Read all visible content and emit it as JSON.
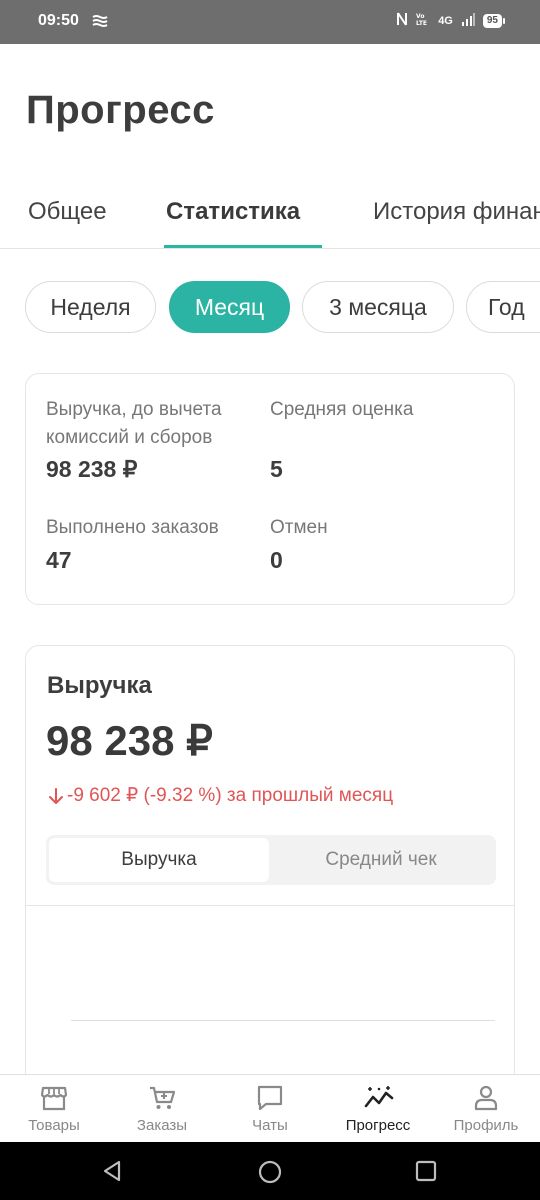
{
  "status_bar": {
    "time": "09:50",
    "network": "4G",
    "battery": "95"
  },
  "header": {
    "title": "Прогресс"
  },
  "tabs": [
    {
      "label": "Общее"
    },
    {
      "label": "Статистика"
    },
    {
      "label": "История финансов"
    }
  ],
  "periods": [
    {
      "label": "Неделя"
    },
    {
      "label": "Месяц"
    },
    {
      "label": "3 месяца"
    },
    {
      "label": "Год"
    }
  ],
  "summary": {
    "revenue_label": "Выручка, до вычета комиссий и сборов",
    "revenue_value": "98 238 ₽",
    "rating_label": "Средняя оценка",
    "rating_value": "5",
    "orders_label": "Выполнено заказов",
    "orders_value": "47",
    "cancels_label": "Отмен",
    "cancels_value": "0"
  },
  "revenue_card": {
    "title": "Выручка",
    "amount": "98 238 ₽",
    "change": "-9 602 ₽ (-9.32 %) за прошлый месяц",
    "change_color": "#e05555",
    "segments": [
      {
        "label": "Выручка"
      },
      {
        "label": "Средний чек"
      }
    ]
  },
  "bottom_nav": [
    {
      "label": "Товары",
      "icon": "store-icon"
    },
    {
      "label": "Заказы",
      "icon": "cart-icon"
    },
    {
      "label": "Чаты",
      "icon": "chat-icon"
    },
    {
      "label": "Прогресс",
      "icon": "progress-chart-icon"
    },
    {
      "label": "Профиль",
      "icon": "profile-icon"
    }
  ],
  "colors": {
    "accent": "#2bb3a3",
    "status_bar": "#6e6e6e"
  }
}
